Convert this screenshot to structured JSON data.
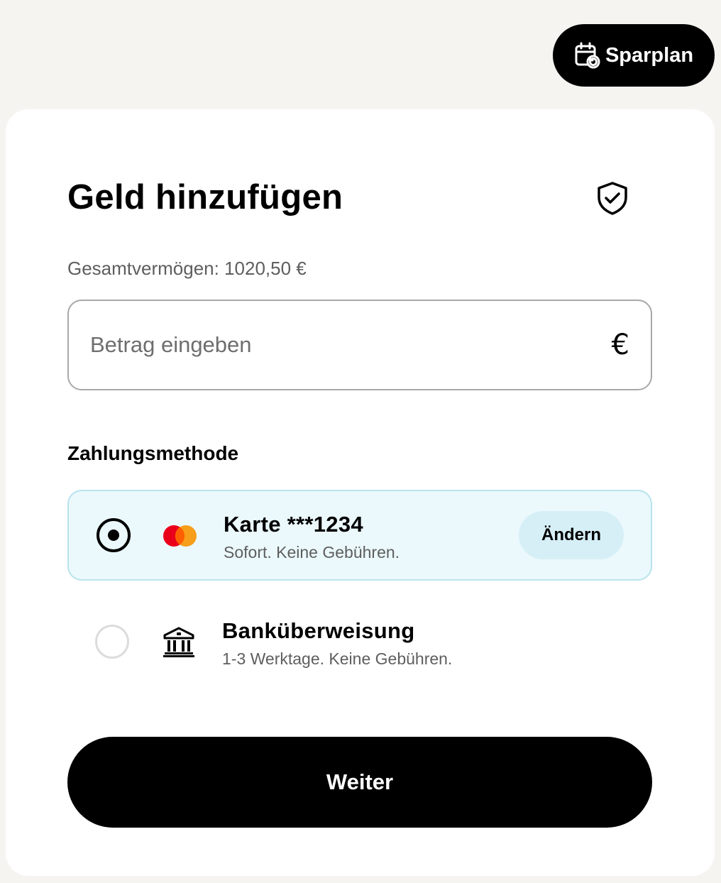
{
  "header": {
    "sparplan_label": "Sparplan",
    "sparplan_icon": "calendar-repeat-icon"
  },
  "dialog": {
    "title": "Geld hinzufügen",
    "security_icon": "shield-check-icon",
    "total_assets": "Gesamtvermögen: 1020,50 €",
    "amount_input": {
      "value": "",
      "placeholder": "Betrag eingeben",
      "currency_symbol": "€"
    },
    "payment_section_label": "Zahlungsmethode",
    "payment_methods": [
      {
        "title": "Karte ***1234",
        "subtitle": "Sofort. Keine Gebühren.",
        "selected": true,
        "icon": "mastercard-icon",
        "action_label": "Ändern"
      },
      {
        "title": "Banküberweisung",
        "subtitle": "1-3 Werktage. Keine Gebühren.",
        "selected": false,
        "icon": "bank-icon"
      }
    ],
    "continue_label": "Weiter"
  },
  "colors": {
    "page_background": "#f5f4f1",
    "card_background": "#ffffff",
    "selected_method_background": "#ebf9fc",
    "selected_method_border": "#b9e3ee",
    "change_button_background": "#d6eff7",
    "primary_button": "#000000",
    "mastercard_red": "#eb001b",
    "mastercard_orange": "#f79e1b"
  }
}
